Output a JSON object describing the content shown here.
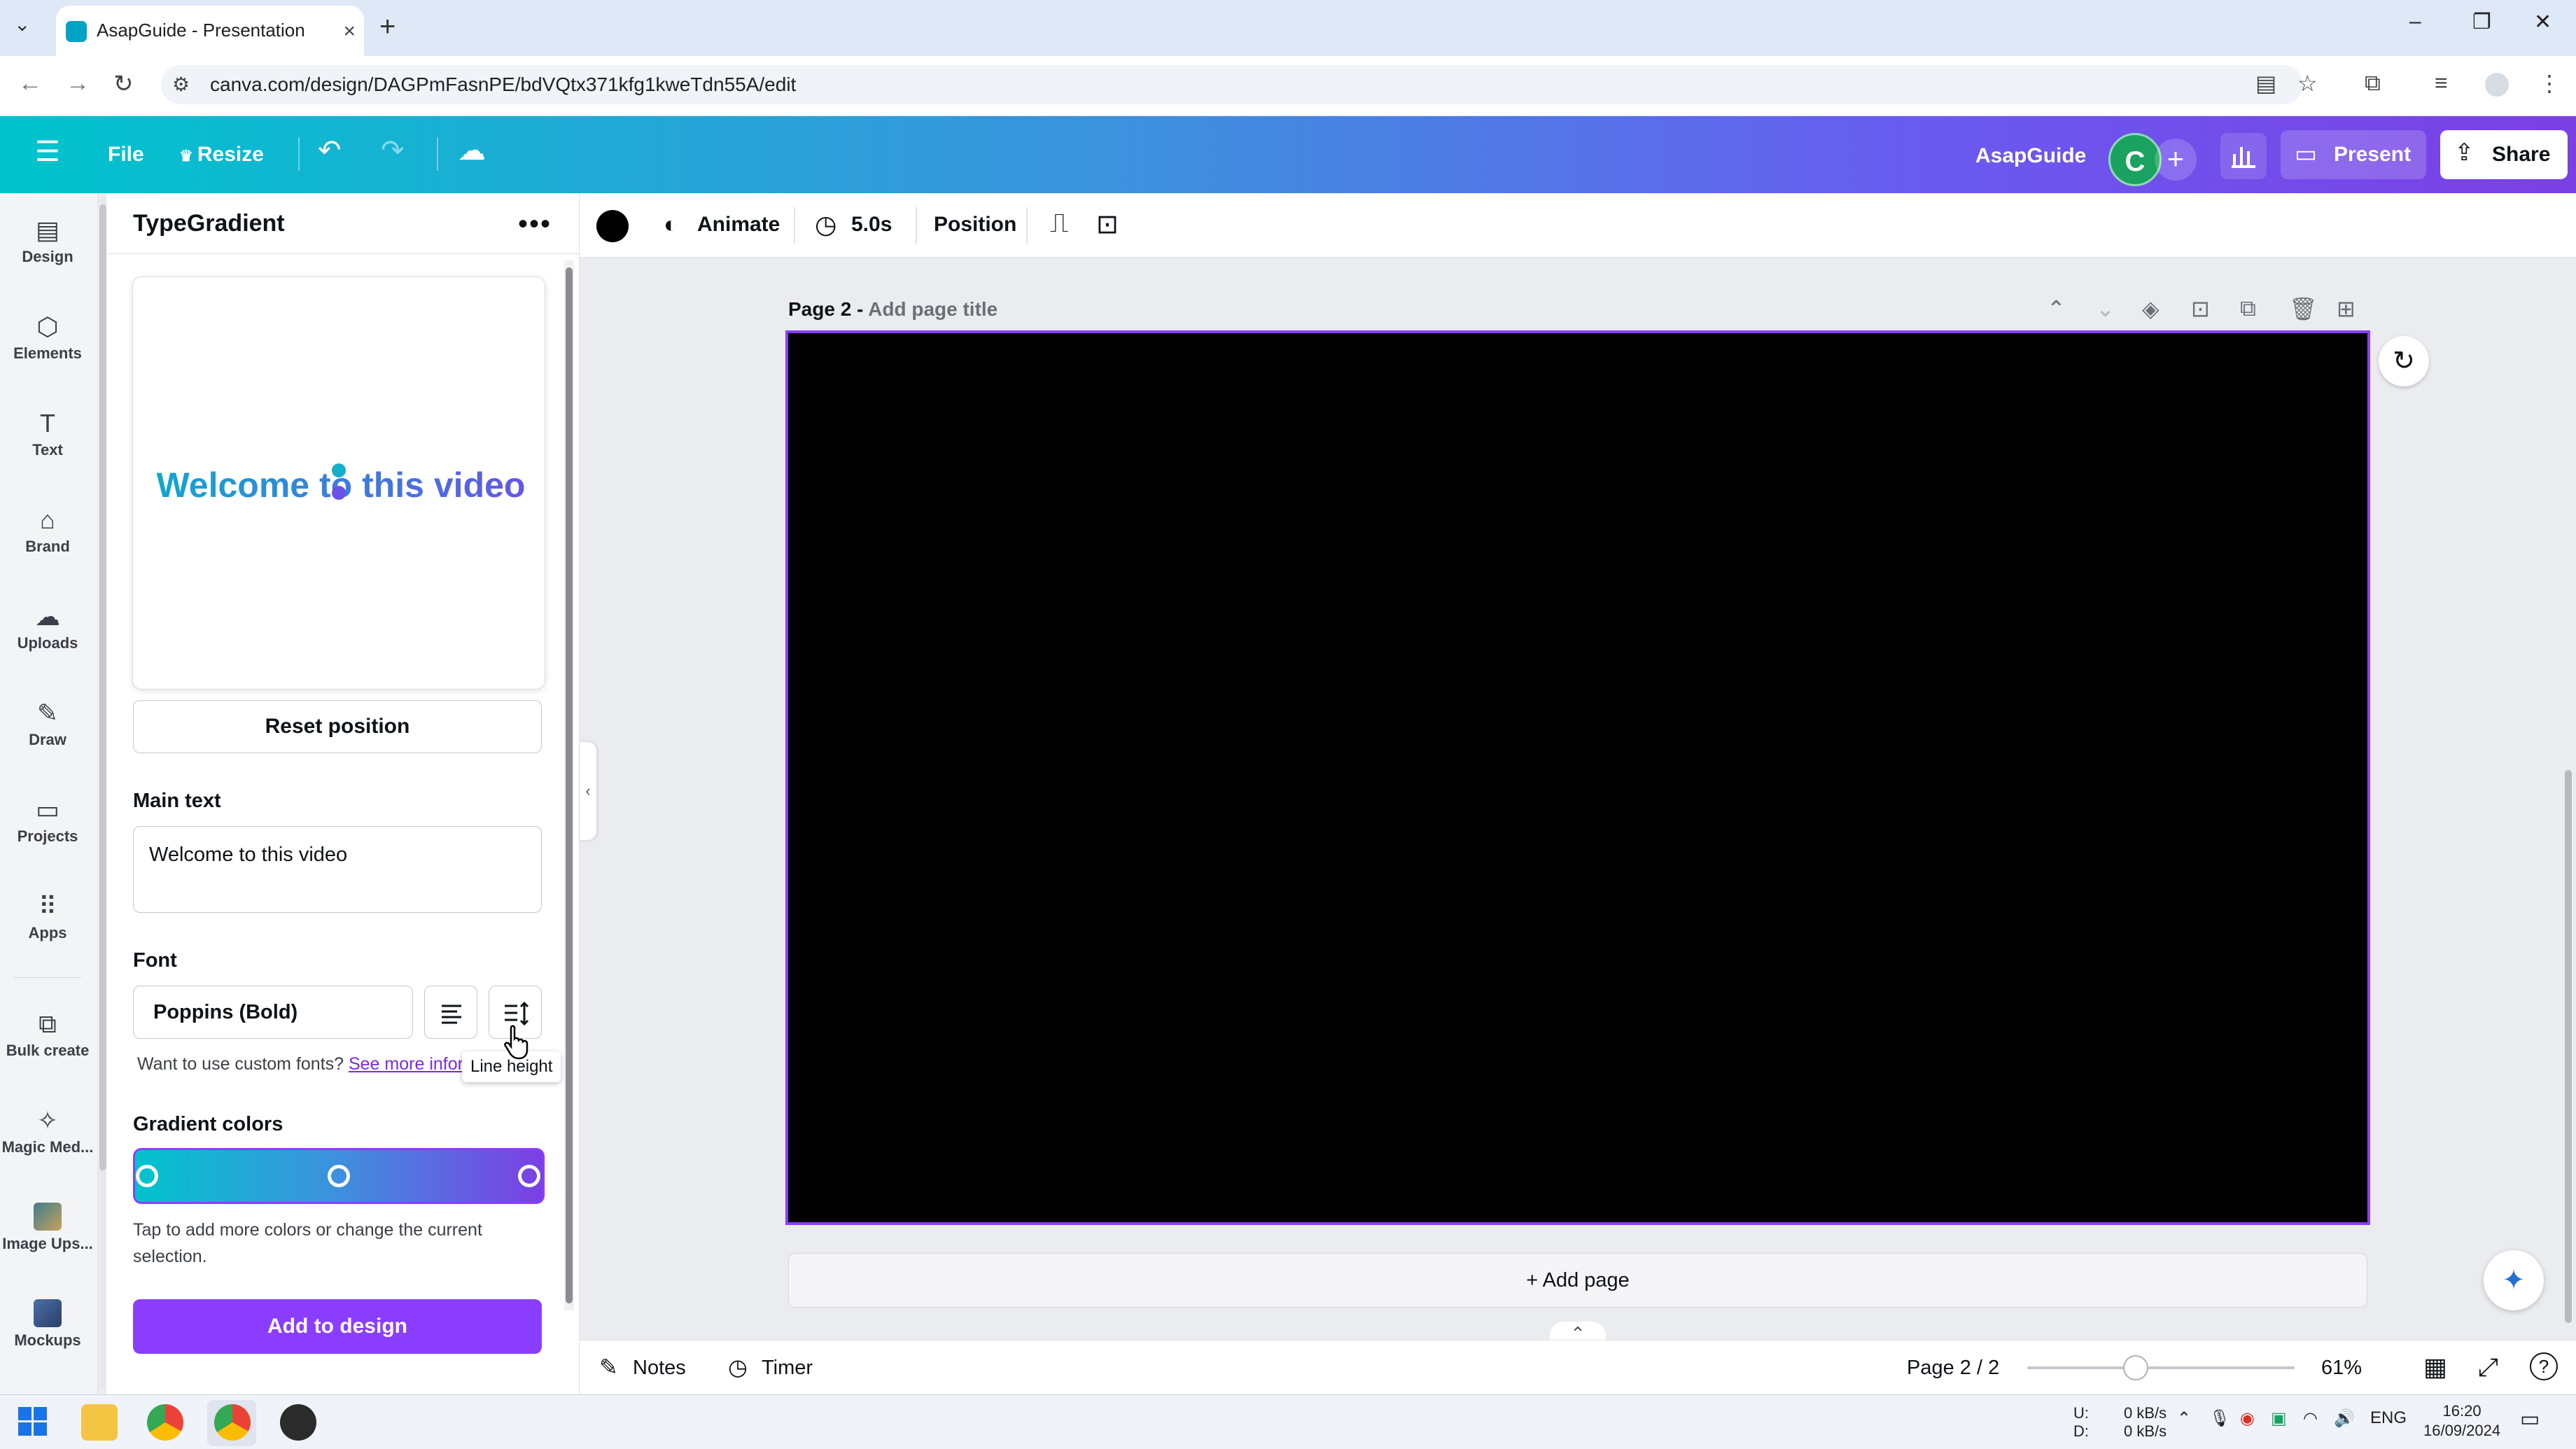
{
  "browser": {
    "tab_title": "AsapGuide - Presentation",
    "url": "canva.com/design/DAGPmFasnPE/bdVQtx371kfg1kweTdn55A/edit"
  },
  "header": {
    "file_label": "File",
    "resize_label": "Resize",
    "brand_name": "AsapGuide",
    "avatar_letter": "C",
    "present_label": "Present",
    "share_label": "Share"
  },
  "rail": {
    "items": [
      {
        "label": "Design",
        "icon": "design-icon"
      },
      {
        "label": "Elements",
        "icon": "elements-icon"
      },
      {
        "label": "Text",
        "icon": "text-icon"
      },
      {
        "label": "Brand",
        "icon": "brand-icon"
      },
      {
        "label": "Uploads",
        "icon": "uploads-icon"
      },
      {
        "label": "Draw",
        "icon": "draw-icon"
      },
      {
        "label": "Projects",
        "icon": "projects-icon"
      },
      {
        "label": "Apps",
        "icon": "apps-icon"
      },
      {
        "label": "Bulk create",
        "icon": "bulk-create-icon"
      },
      {
        "label": "Magic Med...",
        "icon": "magic-media-icon"
      },
      {
        "label": "Image Ups...",
        "icon": "image-upscaler-icon"
      },
      {
        "label": "Mockups",
        "icon": "mockups-icon"
      }
    ]
  },
  "panel": {
    "title": "TypeGradient",
    "preview_text": "Welcome to this video",
    "reset_label": "Reset position",
    "main_text_label": "Main text",
    "main_text_value": "Welcome to this video",
    "font_label": "Font",
    "font_value": "Poppins (Bold)",
    "custom_fonts_prompt": "Want to use custom fonts?",
    "custom_fonts_link": "See more infor",
    "tooltip": "Line height",
    "gradient_label": "Gradient colors",
    "gradient_colors": [
      "#00c4cc",
      "#3e90de",
      "#7b3fe4"
    ],
    "gradient_hint": "Tap to add more colors or change the current selection.",
    "add_label": "Add to design"
  },
  "toolbar": {
    "color": "#000000",
    "animate_label": "Animate",
    "duration_label": "5.0s",
    "position_label": "Position"
  },
  "workspace": {
    "page_prefix": "Page 2 -",
    "page_title_placeholder": "Add page title",
    "add_page_label": "+ Add page"
  },
  "bottom": {
    "notes_label": "Notes",
    "timer_label": "Timer",
    "page_indicator": "Page 2 / 2",
    "zoom_label": "61%",
    "zoom_level": 61
  },
  "taskbar": {
    "net_up_label": "U:",
    "net_down_label": "D:",
    "net_up": "0 kB/s",
    "net_down": "0 kB/s",
    "language": "ENG",
    "time": "16:20",
    "date": "16/09/2024"
  },
  "colors": {
    "accent": "#8b3dff",
    "header_gradient_start": "#00c4cc",
    "header_gradient_end": "#7b3fe4"
  }
}
